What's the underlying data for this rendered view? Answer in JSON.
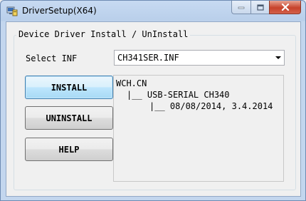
{
  "window": {
    "title": "DriverSetup(X64)"
  },
  "caption_buttons": {
    "minimize_icon": "minimize-icon",
    "maximize_icon": "maximize-icon",
    "close_icon": "close-icon"
  },
  "group": {
    "title": "Device Driver Install / UnInstall"
  },
  "select_inf": {
    "label": "Select INF",
    "value": "CH341SER.INF"
  },
  "buttons": {
    "install": "INSTALL",
    "uninstall": "UNINSTALL",
    "help": "HELP"
  },
  "info": {
    "vendor": "WCH.CN",
    "device": "|__ USB-SERIAL CH340",
    "version": "|__ 08/08/2014, 3.4.2014"
  },
  "colors": {
    "titlebar": "#b9cfea",
    "close_button": "#c7432c",
    "install_focus": "#3c7fb1"
  }
}
